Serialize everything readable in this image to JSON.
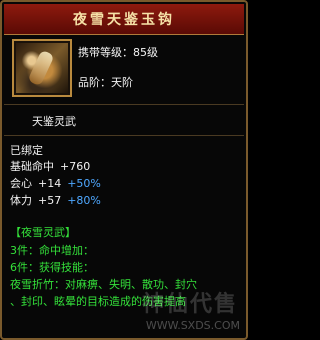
{
  "tooltip": {
    "title": "夜雪天鉴玉钩",
    "level_text": "携带等级：85级",
    "grade_text": "品阶：天阶",
    "subtitle": "天鉴灵武",
    "bound_text": "已绑定",
    "stats": [
      {
        "name": "基础命中",
        "value": "+760",
        "bonus": ""
      },
      {
        "name": "会心",
        "value": "+14",
        "bonus": "+50%"
      },
      {
        "name": "体力",
        "value": "+57",
        "bonus": "+80%"
      }
    ],
    "set_title": "【夜雪灵武】",
    "set_lines": [
      "3件：命中增加：",
      "6件：获得技能：",
      "夜雪折竹：对麻痹、失明、散功、封穴",
      "、封印、眩晕的目标造成的伤害提高"
    ],
    "watermark": {
      "site": "WWW.SXDS.COM",
      "brand": "神仙代售"
    }
  },
  "colors": {
    "title_bg": "#8e1a0e",
    "border": "#b98a3e",
    "green": "#34e03a",
    "blue": "#4fa8ff"
  },
  "icons": {
    "item": "jade-hook-weapon-icon"
  }
}
